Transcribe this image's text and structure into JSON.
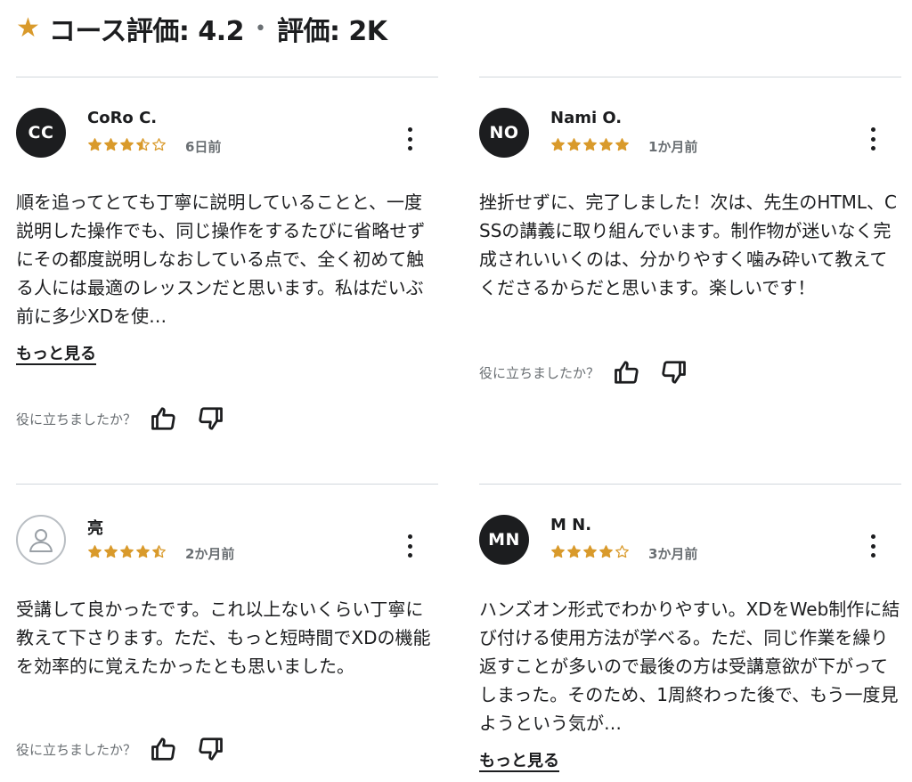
{
  "header": {
    "rating_label": "コース評価: 4.2",
    "separator": "•",
    "count_label": "評価: 2K"
  },
  "colors": {
    "star": "#d99a2b",
    "text": "#1c1d1f",
    "muted": "#6a6f73"
  },
  "helpful_question": "役に立ちましたか？",
  "reviews": [
    {
      "initials": "CC",
      "name": "CoRo C.",
      "rating": 3.5,
      "date": "6日前",
      "text": "順を追ってとても丁寧に説明していることと、一度説明した操作でも、同じ操作をするたびに省略せずにその都度説明しなおしている点で、全く初めて触る人には最適のレッスンだと思います。私はだいぶ前に多少XDを使…",
      "more": "もっと見る"
    },
    {
      "initials": "NO",
      "name": "Nami O.",
      "rating": 5,
      "date": "1か月前",
      "text": "挫折せずに、完了しました！次は、先生のHTML、CSSの講義に取り組んでいます。制作物が迷いなく完成されいいくのは、分かりやすく噛み砕いて教えてくださるからだと思います。楽しいです！"
    },
    {
      "initials": "",
      "avatar_icon": "user-icon",
      "name": "亮",
      "rating": 4.5,
      "date": "2か月前",
      "text": "受講して良かったです。これ以上ないくらい丁寧に教えて下さります。ただ、もっと短時間でXDの機能を効率的に覚えたかったとも思いました。"
    },
    {
      "initials": "MN",
      "name": "M N.",
      "rating": 4,
      "date": "3か月前",
      "text": "ハンズオン形式でわかりやすい。XDをWeb制作に結び付ける使用方法が学べる。ただ、同じ作業を繰り返すことが多いので最後の方は受講意欲が下がってしまった。そのため、1周終わった後で、もう一度見ようという気が…",
      "more": "もっと見る"
    }
  ]
}
